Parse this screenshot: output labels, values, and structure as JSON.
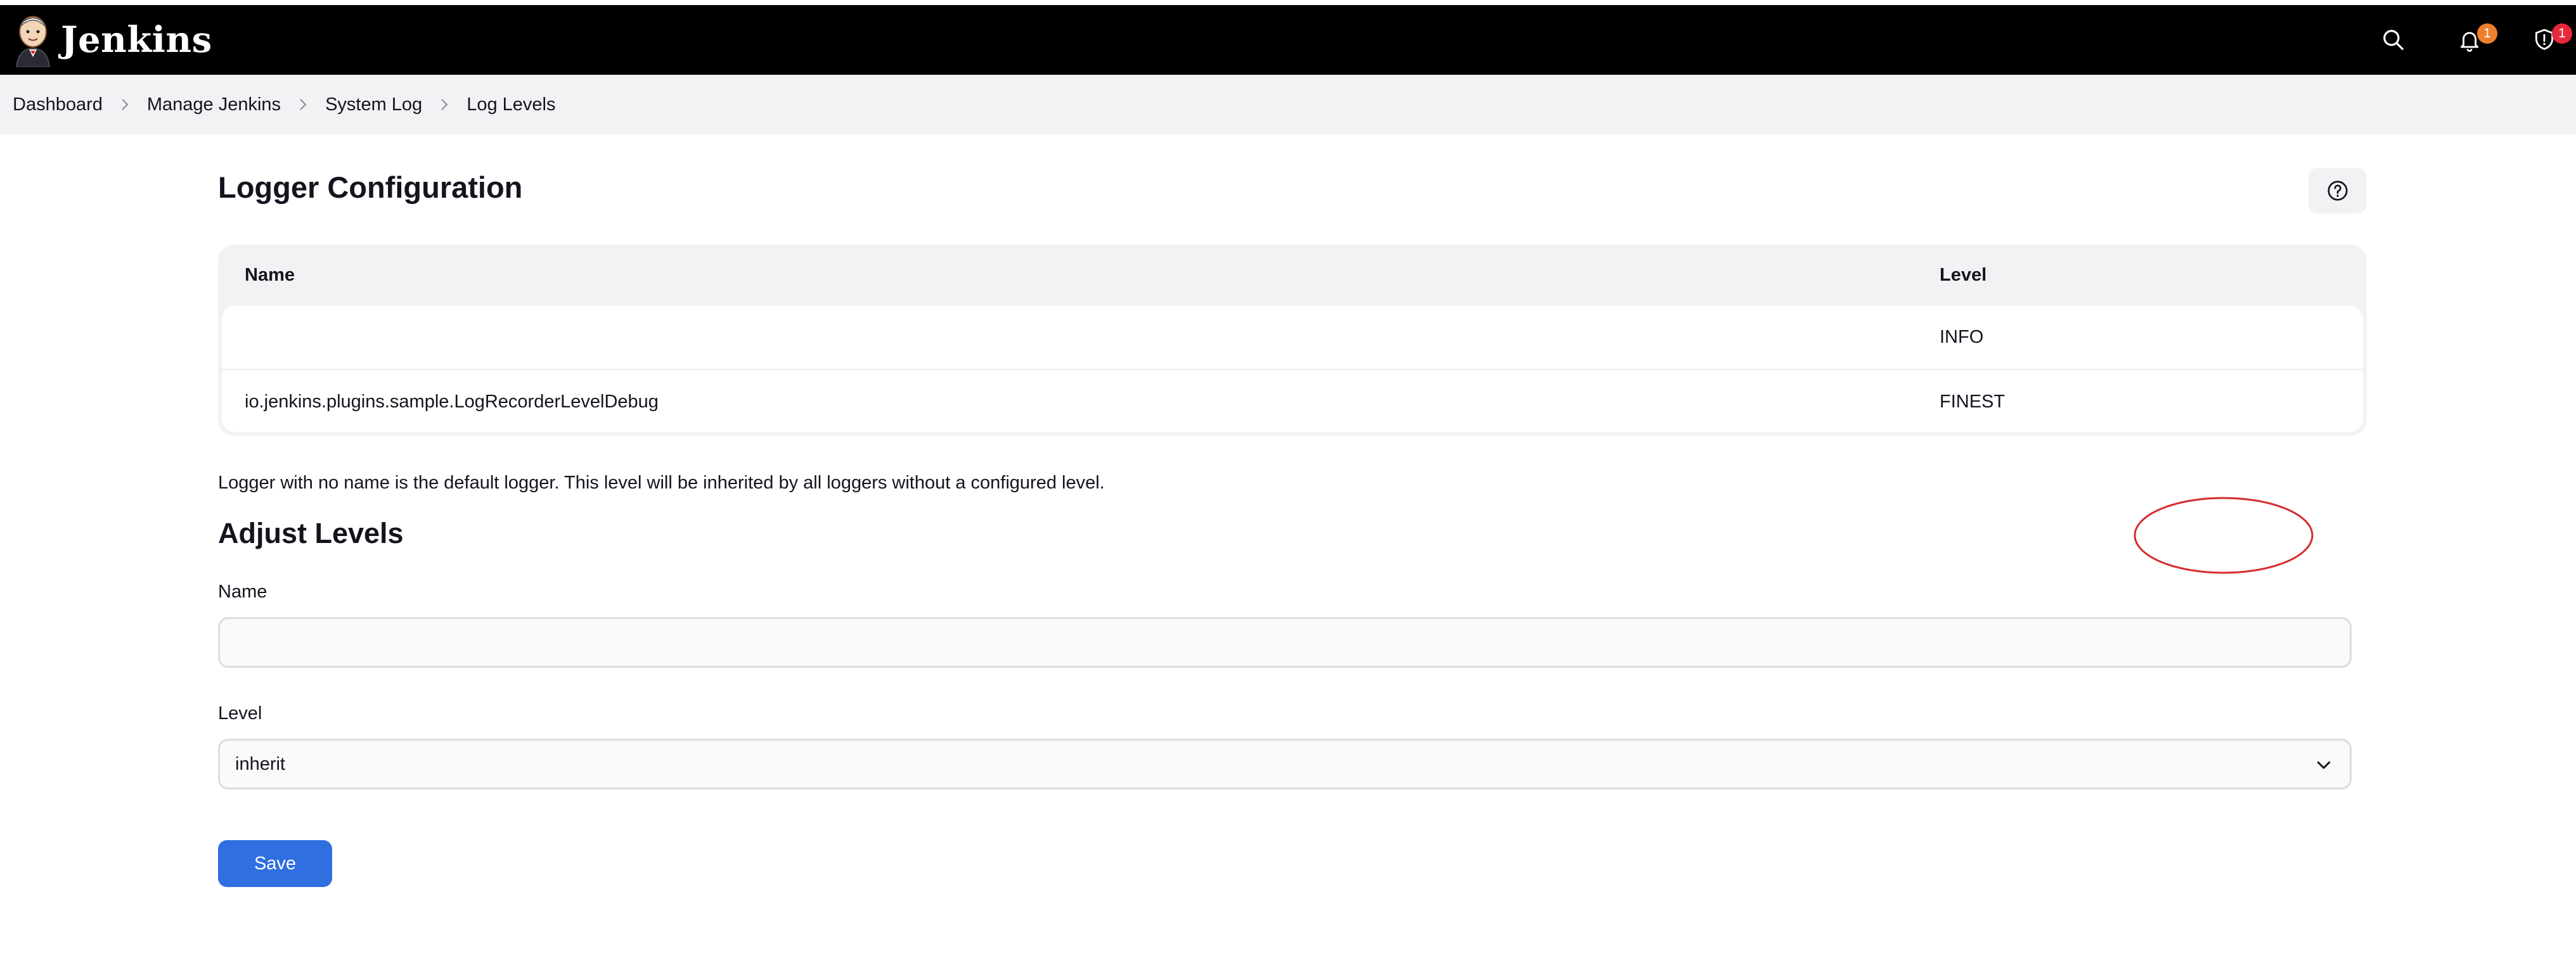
{
  "app": {
    "name": "Jenkins"
  },
  "header": {
    "notifications_count": "1",
    "security_count": "1",
    "colors": {
      "bar": "#000000",
      "notification_badge": "#ee7f2d",
      "security_badge": "#e6283a"
    },
    "icons": [
      "jenkins-logo-icon",
      "search-icon",
      "bell-icon",
      "shield-icon"
    ]
  },
  "breadcrumb": [
    "Dashboard",
    "Manage Jenkins",
    "System Log",
    "Log Levels"
  ],
  "logger_config": {
    "title": "Logger Configuration",
    "columns": {
      "name": "Name",
      "level": "Level"
    },
    "rows": [
      {
        "name": "",
        "level": "INFO"
      },
      {
        "name": "io.jenkins.plugins.sample.LogRecorderLevelDebug",
        "level": "FINEST",
        "annotated": true
      }
    ],
    "note": "Logger with no name is the default logger. This level will be inherited by all loggers without a configured level."
  },
  "adjust_levels": {
    "title": "Adjust Levels",
    "name_label": "Name",
    "name_value": "",
    "level_label": "Level",
    "level_value": "inherit",
    "save_label": "Save"
  },
  "annotation_color": "#d62b2b",
  "accent_color": "#2f6fe0"
}
